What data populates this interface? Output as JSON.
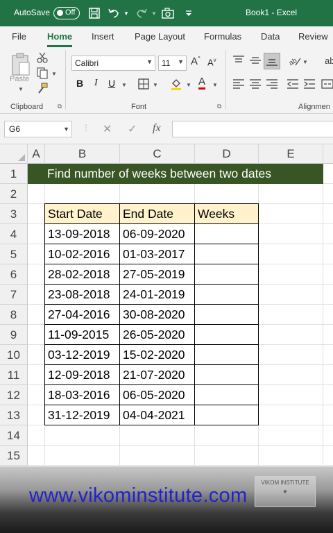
{
  "titlebar": {
    "autosave_label": "AutoSave",
    "autosave_state": "Off",
    "doc_title": "Book1  -  Excel",
    "color": "#217346"
  },
  "tabs": [
    "File",
    "Home",
    "Insert",
    "Page Layout",
    "Formulas",
    "Data",
    "Review"
  ],
  "active_tab": "Home",
  "ribbon": {
    "paste_label": "Paste",
    "font_name": "Calibri",
    "font_size": "11",
    "bold": "B",
    "italic": "I",
    "underline": "U",
    "font_grow": "A",
    "font_shrink": "A",
    "font_color": "A",
    "groups": {
      "clipboard": "Clipboard",
      "font": "Font",
      "alignment": "Alignmen"
    }
  },
  "formula_bar": {
    "name_box": "G6",
    "cancel": "✕",
    "enter": "✓",
    "fx": "fx",
    "value": ""
  },
  "sheet": {
    "columns": [
      "A",
      "B",
      "C",
      "D",
      "E"
    ],
    "rows": [
      "1",
      "2",
      "3",
      "4",
      "5",
      "6",
      "7",
      "8",
      "9",
      "10",
      "11",
      "12",
      "13",
      "14",
      "15"
    ],
    "title": "Find number of weeks between two dates",
    "table_headers": [
      "Start Date",
      "End Date",
      "Weeks"
    ],
    "table_rows": [
      [
        "13-09-2018",
        "06-09-2020",
        ""
      ],
      [
        "10-02-2016",
        "01-03-2017",
        ""
      ],
      [
        "28-02-2018",
        "27-05-2019",
        ""
      ],
      [
        "23-08-2018",
        "24-01-2019",
        ""
      ],
      [
        "27-04-2016",
        "30-08-2020",
        ""
      ],
      [
        "11-09-2015",
        "26-05-2020",
        ""
      ],
      [
        "03-12-2019",
        "15-02-2020",
        ""
      ],
      [
        "12-09-2018",
        "21-07-2020",
        ""
      ],
      [
        "18-03-2016",
        "06-05-2020",
        ""
      ],
      [
        "31-12-2019",
        "04-04-2021",
        ""
      ]
    ],
    "title_bg": "#375623",
    "header_bg": "#fff2cc"
  },
  "watermark": {
    "website": "www.vikominstitute.com",
    "logo_text": "VIKOM INSTITUTE"
  }
}
